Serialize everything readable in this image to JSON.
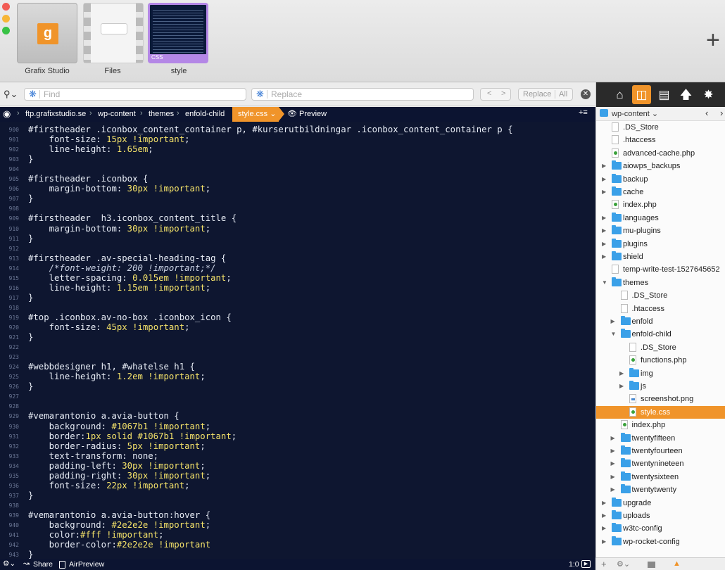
{
  "window": {
    "docs": [
      {
        "name": "Grafix Studio",
        "logo": "g"
      },
      {
        "name": "Files"
      },
      {
        "name": "style",
        "tag": "CSS"
      }
    ],
    "new_tab_icon": "plus-icon"
  },
  "search": {
    "find_placeholder": "Find",
    "replace_placeholder": "Replace",
    "prev": "<",
    "next": ">",
    "replace_label": "Replace",
    "all_label": "All"
  },
  "breadcrumb": {
    "items": [
      "ftp.grafixstudio.se",
      "wp-content",
      "themes",
      "enfold-child"
    ],
    "active": "style.css ⌄",
    "preview": "Preview"
  },
  "editor": {
    "lines": [
      {
        "n": "900",
        "parts": [
          {
            "t": "#firstheader .iconbox_content_container p, #kurserutbildningar .iconbox_content_container p {"
          }
        ]
      },
      {
        "n": "901",
        "parts": [
          {
            "t": "    font-size: "
          },
          {
            "t": "15px !important",
            "c": "v"
          },
          {
            "t": ";"
          }
        ]
      },
      {
        "n": "902",
        "parts": [
          {
            "t": "    line-height: "
          },
          {
            "t": "1.65em",
            "c": "v"
          },
          {
            "t": ";"
          }
        ]
      },
      {
        "n": "903",
        "parts": [
          {
            "t": "}"
          }
        ]
      },
      {
        "n": "904",
        "parts": []
      },
      {
        "n": "905",
        "parts": [
          {
            "t": "#firstheader .iconbox {"
          }
        ]
      },
      {
        "n": "906",
        "parts": [
          {
            "t": "    margin-bottom: "
          },
          {
            "t": "30px !important",
            "c": "v"
          },
          {
            "t": ";"
          }
        ]
      },
      {
        "n": "907",
        "parts": [
          {
            "t": "}"
          }
        ]
      },
      {
        "n": "908",
        "parts": []
      },
      {
        "n": "909",
        "parts": [
          {
            "t": "#firstheader  h3.iconbox_content_title {"
          }
        ]
      },
      {
        "n": "910",
        "parts": [
          {
            "t": "    margin-bottom: "
          },
          {
            "t": "30px !important",
            "c": "v"
          },
          {
            "t": ";"
          }
        ]
      },
      {
        "n": "911",
        "parts": [
          {
            "t": "}"
          }
        ]
      },
      {
        "n": "912",
        "parts": []
      },
      {
        "n": "913",
        "parts": [
          {
            "t": "#firstheader .av-special-heading-tag {"
          }
        ]
      },
      {
        "n": "914",
        "parts": [
          {
            "t": "    "
          },
          {
            "t": "/*font-weight: 200 !important;*/",
            "c": "c"
          }
        ]
      },
      {
        "n": "915",
        "parts": [
          {
            "t": "    letter-spacing: "
          },
          {
            "t": "0.015em !important",
            "c": "v"
          },
          {
            "t": ";"
          }
        ]
      },
      {
        "n": "916",
        "parts": [
          {
            "t": "    line-height: "
          },
          {
            "t": "1.15em !important",
            "c": "v"
          },
          {
            "t": ";"
          }
        ]
      },
      {
        "n": "917",
        "parts": [
          {
            "t": "}"
          }
        ]
      },
      {
        "n": "918",
        "parts": []
      },
      {
        "n": "919",
        "parts": [
          {
            "t": "#top .iconbox.av-no-box .iconbox_icon {"
          }
        ]
      },
      {
        "n": "920",
        "parts": [
          {
            "t": "    font-size: "
          },
          {
            "t": "45px !important",
            "c": "v"
          },
          {
            "t": ";"
          }
        ]
      },
      {
        "n": "921",
        "parts": [
          {
            "t": "}"
          }
        ]
      },
      {
        "n": "922",
        "parts": []
      },
      {
        "n": "923",
        "parts": []
      },
      {
        "n": "924",
        "parts": [
          {
            "t": "#webbdesigner h1, #whatelse h1 {"
          }
        ]
      },
      {
        "n": "925",
        "parts": [
          {
            "t": "    line-height: "
          },
          {
            "t": "1.2em !important",
            "c": "v"
          },
          {
            "t": ";"
          }
        ]
      },
      {
        "n": "926",
        "parts": [
          {
            "t": "}"
          }
        ]
      },
      {
        "n": "927",
        "parts": []
      },
      {
        "n": "928",
        "parts": []
      },
      {
        "n": "929",
        "parts": [
          {
            "t": "#vemarantonio a.avia-button {"
          }
        ]
      },
      {
        "n": "930",
        "parts": [
          {
            "t": "    background: "
          },
          {
            "t": "#1067b1 !important",
            "c": "v"
          },
          {
            "t": ";"
          }
        ]
      },
      {
        "n": "931",
        "parts": [
          {
            "t": "    border:"
          },
          {
            "t": "1px solid #1067b1 !important",
            "c": "v"
          },
          {
            "t": ";"
          }
        ]
      },
      {
        "n": "932",
        "parts": [
          {
            "t": "    border-radius: "
          },
          {
            "t": "5px !important",
            "c": "v"
          },
          {
            "t": ";"
          }
        ]
      },
      {
        "n": "933",
        "parts": [
          {
            "t": "    text-transform: none;"
          }
        ]
      },
      {
        "n": "934",
        "parts": [
          {
            "t": "    padding-left: "
          },
          {
            "t": "30px !important",
            "c": "v"
          },
          {
            "t": ";"
          }
        ]
      },
      {
        "n": "935",
        "parts": [
          {
            "t": "    padding-right: "
          },
          {
            "t": "30px !important",
            "c": "v"
          },
          {
            "t": ";"
          }
        ]
      },
      {
        "n": "936",
        "parts": [
          {
            "t": "    font-size: "
          },
          {
            "t": "22px !important",
            "c": "v"
          },
          {
            "t": ";"
          }
        ]
      },
      {
        "n": "937",
        "parts": [
          {
            "t": "}"
          }
        ]
      },
      {
        "n": "938",
        "parts": []
      },
      {
        "n": "939",
        "parts": [
          {
            "t": "#vemarantonio a.avia-button:hover {"
          }
        ]
      },
      {
        "n": "940",
        "parts": [
          {
            "t": "    background: "
          },
          {
            "t": "#2e2e2e !important",
            "c": "v"
          },
          {
            "t": ";"
          }
        ]
      },
      {
        "n": "941",
        "parts": [
          {
            "t": "    color:"
          },
          {
            "t": "#fff !important",
            "c": "v"
          },
          {
            "t": ";"
          }
        ]
      },
      {
        "n": "942",
        "parts": [
          {
            "t": "    border-color:"
          },
          {
            "t": "#2e2e2e !important",
            "c": "v"
          }
        ]
      },
      {
        "n": "943",
        "parts": [
          {
            "t": "}"
          }
        ]
      }
    ]
  },
  "sidebar": {
    "location": "wp-content ⌄",
    "tree": [
      {
        "name": ".DS_Store",
        "depth": 0,
        "kind": "file"
      },
      {
        "name": ".htaccess",
        "depth": 0,
        "kind": "file"
      },
      {
        "name": "advanced-cache.php",
        "depth": 0,
        "kind": "php"
      },
      {
        "name": "aiowps_backups",
        "depth": 0,
        "kind": "folder",
        "toggle": "closed"
      },
      {
        "name": "backup",
        "depth": 0,
        "kind": "folder",
        "toggle": "closed"
      },
      {
        "name": "cache",
        "depth": 0,
        "kind": "folder",
        "toggle": "closed"
      },
      {
        "name": "index.php",
        "depth": 0,
        "kind": "php"
      },
      {
        "name": "languages",
        "depth": 0,
        "kind": "folder",
        "toggle": "closed"
      },
      {
        "name": "mu-plugins",
        "depth": 0,
        "kind": "folder",
        "toggle": "closed"
      },
      {
        "name": "plugins",
        "depth": 0,
        "kind": "folder",
        "toggle": "closed"
      },
      {
        "name": "shield",
        "depth": 0,
        "kind": "folder",
        "toggle": "closed"
      },
      {
        "name": "temp-write-test-1527645652",
        "depth": 0,
        "kind": "file"
      },
      {
        "name": "themes",
        "depth": 0,
        "kind": "folder",
        "toggle": "open"
      },
      {
        "name": ".DS_Store",
        "depth": 1,
        "kind": "file"
      },
      {
        "name": ".htaccess",
        "depth": 1,
        "kind": "file"
      },
      {
        "name": "enfold",
        "depth": 1,
        "kind": "folder",
        "toggle": "closed"
      },
      {
        "name": "enfold-child",
        "depth": 1,
        "kind": "folder",
        "toggle": "open"
      },
      {
        "name": ".DS_Store",
        "depth": 2,
        "kind": "file"
      },
      {
        "name": "functions.php",
        "depth": 2,
        "kind": "php"
      },
      {
        "name": "img",
        "depth": 2,
        "kind": "folder",
        "toggle": "closed"
      },
      {
        "name": "js",
        "depth": 2,
        "kind": "folder",
        "toggle": "closed"
      },
      {
        "name": "screenshot.png",
        "depth": 2,
        "kind": "png"
      },
      {
        "name": "style.css",
        "depth": 2,
        "kind": "php",
        "selected": true
      },
      {
        "name": "index.php",
        "depth": 1,
        "kind": "php"
      },
      {
        "name": "twentyfifteen",
        "depth": 1,
        "kind": "folder",
        "toggle": "closed"
      },
      {
        "name": "twentyfourteen",
        "depth": 1,
        "kind": "folder",
        "toggle": "closed"
      },
      {
        "name": "twentynineteen",
        "depth": 1,
        "kind": "folder",
        "toggle": "closed"
      },
      {
        "name": "twentysixteen",
        "depth": 1,
        "kind": "folder",
        "toggle": "closed"
      },
      {
        "name": "twentytwenty",
        "depth": 1,
        "kind": "folder",
        "toggle": "closed"
      },
      {
        "name": "upgrade",
        "depth": 0,
        "kind": "folder",
        "toggle": "closed"
      },
      {
        "name": "uploads",
        "depth": 0,
        "kind": "folder",
        "toggle": "closed"
      },
      {
        "name": "w3tc-config",
        "depth": 0,
        "kind": "folder",
        "toggle": "closed"
      },
      {
        "name": "wp-rocket-config",
        "depth": 0,
        "kind": "folder",
        "toggle": "closed"
      }
    ]
  },
  "statusbar": {
    "share": "Share",
    "airpreview": "AirPreview",
    "position": "1:0"
  },
  "colors": {
    "accent": "#f0942a",
    "editor_bg": "#0e1630",
    "value": "#f5e36a"
  }
}
